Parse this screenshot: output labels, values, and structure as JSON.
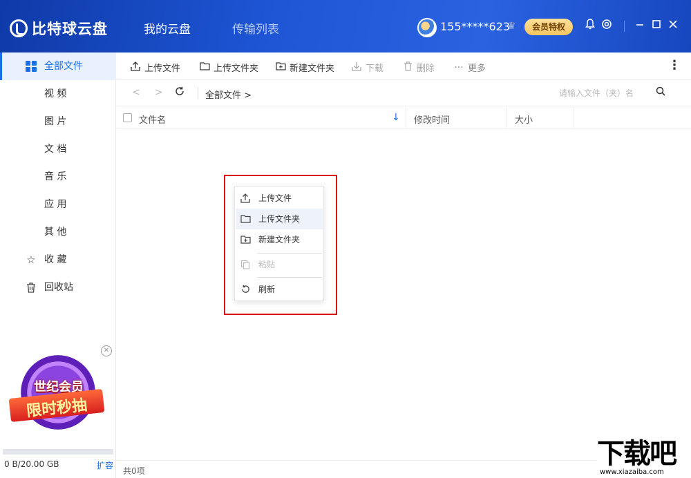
{
  "header": {
    "logo_text": "比特球云盘",
    "tabs": [
      {
        "label": "我的云盘"
      },
      {
        "label": "传输列表"
      }
    ],
    "username": "155*****623",
    "vip_button": "会员特权",
    "icons": [
      "bell-icon",
      "gear-icon",
      "minimize-icon",
      "maximize-icon",
      "close-icon"
    ]
  },
  "sidebar": {
    "items": [
      {
        "label": "全部文件",
        "icon": "grid-icon",
        "active": true
      },
      {
        "label": "视 频"
      },
      {
        "label": "图 片"
      },
      {
        "label": "文 档"
      },
      {
        "label": "音 乐"
      },
      {
        "label": "应 用"
      },
      {
        "label": "其 他"
      },
      {
        "label": "收 藏",
        "icon": "star-icon"
      },
      {
        "label": "回收站",
        "icon": "trash-icon"
      }
    ],
    "promo": {
      "line1": "世纪会员",
      "line2": "限时秒抽"
    },
    "quota": "0 B/20.00 GB",
    "expand_label": "扩容"
  },
  "toolbar": {
    "upload_file": "上传文件",
    "upload_folder": "上传文件夹",
    "new_folder": "新建文件夹",
    "download": "下载",
    "delete": "删除",
    "more": "更多"
  },
  "nav": {
    "breadcrumb": "全部文件 >",
    "search_placeholder": "请输入文件（夹）名"
  },
  "table": {
    "columns": [
      "文件名",
      "修改时间",
      "大小"
    ]
  },
  "context_menu": {
    "items": [
      {
        "label": "上传文件",
        "icon": "upload-icon"
      },
      {
        "label": "上传文件夹",
        "icon": "folder-icon",
        "hover": true
      },
      {
        "label": "新建文件夹",
        "icon": "new-folder-icon"
      },
      {
        "label": "粘贴",
        "icon": "paste-icon",
        "disabled": true
      },
      {
        "label": "刷新",
        "icon": "refresh-icon"
      }
    ]
  },
  "status": {
    "count_text": "共0项"
  },
  "watermark": {
    "big": "下载吧",
    "small": "www.xiazaiba.com"
  },
  "colors": {
    "accent": "#1a6fe6",
    "header": "#1e56d6",
    "vip": "#f4c560",
    "highlight": "#d81414"
  }
}
